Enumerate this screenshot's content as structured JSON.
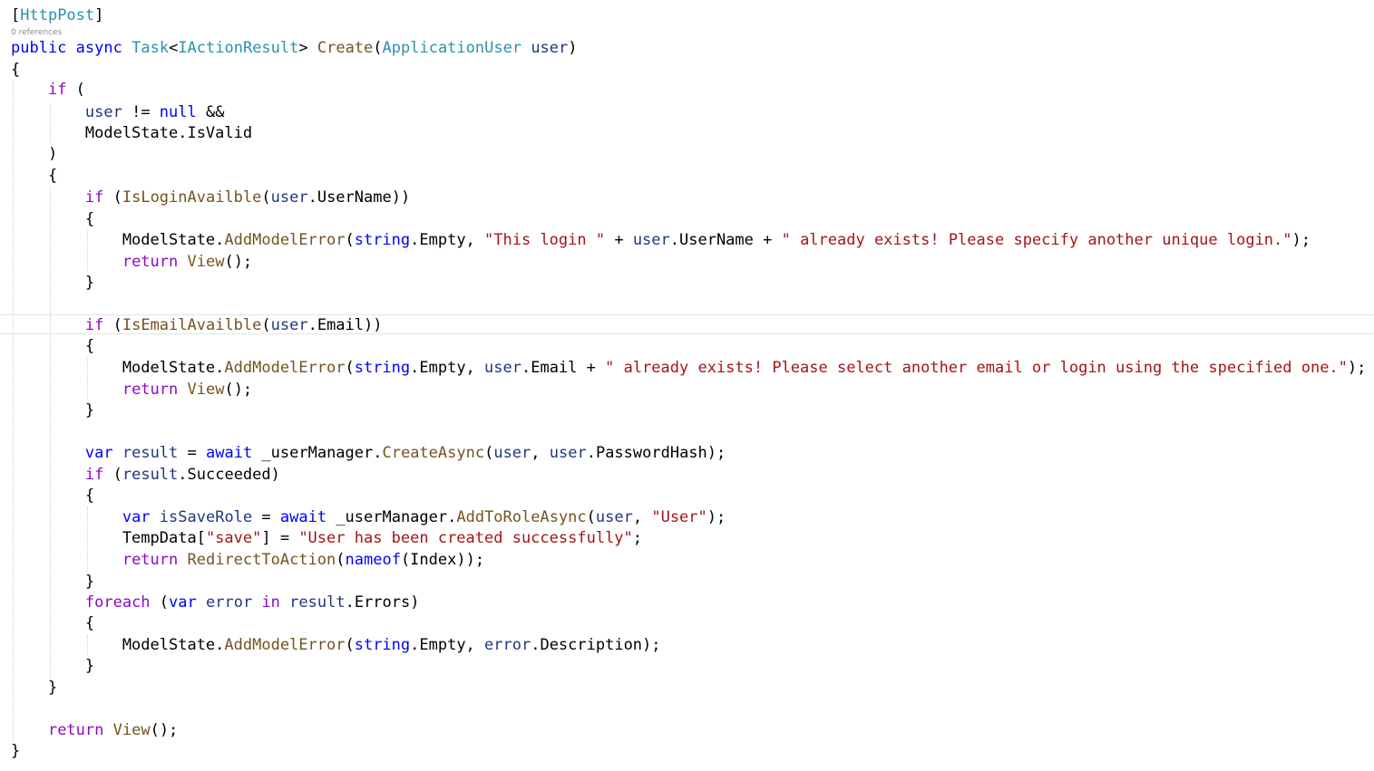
{
  "codelens_text": "0 references",
  "colors": {
    "keyword": "#0000ff",
    "type": "#2b91af",
    "method": "#74531f",
    "string": "#a31515",
    "local_variable": "#1f377f",
    "control_keyword": "#8f08c4",
    "plain": "#000000"
  },
  "lines": [
    [
      [
        "plain",
        "["
      ],
      [
        "type",
        "HttpPost"
      ],
      [
        "plain",
        "]"
      ]
    ],
    [
      [
        "kw",
        "public"
      ],
      [
        "plain",
        " "
      ],
      [
        "kw",
        "async"
      ],
      [
        "plain",
        " "
      ],
      [
        "type",
        "Task"
      ],
      [
        "plain",
        "<"
      ],
      [
        "type",
        "IActionResult"
      ],
      [
        "plain",
        "> "
      ],
      [
        "method",
        "Create"
      ],
      [
        "plain",
        "("
      ],
      [
        "type",
        "ApplicationUser"
      ],
      [
        "plain",
        " "
      ],
      [
        "var",
        "user"
      ],
      [
        "plain",
        ")"
      ]
    ],
    [
      [
        "plain",
        "{"
      ]
    ],
    [
      [
        "plain",
        "    "
      ],
      [
        "ctrl",
        "if"
      ],
      [
        "plain",
        " ("
      ]
    ],
    [
      [
        "plain",
        "        "
      ],
      [
        "var",
        "user"
      ],
      [
        "plain",
        " != "
      ],
      [
        "kw",
        "null"
      ],
      [
        "plain",
        " &&"
      ]
    ],
    [
      [
        "plain",
        "        ModelState.IsValid"
      ]
    ],
    [
      [
        "plain",
        "    )"
      ]
    ],
    [
      [
        "plain",
        "    {"
      ]
    ],
    [
      [
        "plain",
        "        "
      ],
      [
        "ctrl",
        "if"
      ],
      [
        "plain",
        " ("
      ],
      [
        "method",
        "IsLoginAvailble"
      ],
      [
        "plain",
        "("
      ],
      [
        "var",
        "user"
      ],
      [
        "plain",
        ".UserName))"
      ]
    ],
    [
      [
        "plain",
        "        {"
      ]
    ],
    [
      [
        "plain",
        "            ModelState."
      ],
      [
        "method",
        "AddModelError"
      ],
      [
        "plain",
        "("
      ],
      [
        "kw",
        "string"
      ],
      [
        "plain",
        ".Empty, "
      ],
      [
        "str",
        "\"This login \""
      ],
      [
        "plain",
        " + "
      ],
      [
        "var",
        "user"
      ],
      [
        "plain",
        ".UserName + "
      ],
      [
        "str",
        "\" already exists! Please specify another unique login.\""
      ],
      [
        "plain",
        ");"
      ]
    ],
    [
      [
        "plain",
        "            "
      ],
      [
        "ctrl",
        "return"
      ],
      [
        "plain",
        " "
      ],
      [
        "method",
        "View"
      ],
      [
        "plain",
        "();"
      ]
    ],
    [
      [
        "plain",
        "        }"
      ]
    ],
    [],
    [
      [
        "plain",
        "        "
      ],
      [
        "ctrl",
        "if"
      ],
      [
        "plain",
        " ("
      ],
      [
        "method",
        "IsEmailAvailble"
      ],
      [
        "plain",
        "("
      ],
      [
        "var",
        "user"
      ],
      [
        "plain",
        ".Email))"
      ]
    ],
    [
      [
        "plain",
        "        {"
      ]
    ],
    [
      [
        "plain",
        "            ModelState."
      ],
      [
        "method",
        "AddModelError"
      ],
      [
        "plain",
        "("
      ],
      [
        "kw",
        "string"
      ],
      [
        "plain",
        ".Empty, "
      ],
      [
        "var",
        "user"
      ],
      [
        "plain",
        ".Email + "
      ],
      [
        "str",
        "\" already exists! Please select another email or login using the specified one.\""
      ],
      [
        "plain",
        ");"
      ]
    ],
    [
      [
        "plain",
        "            "
      ],
      [
        "ctrl",
        "return"
      ],
      [
        "plain",
        " "
      ],
      [
        "method",
        "View"
      ],
      [
        "plain",
        "();"
      ]
    ],
    [
      [
        "plain",
        "        }"
      ]
    ],
    [],
    [
      [
        "plain",
        "        "
      ],
      [
        "kw",
        "var"
      ],
      [
        "plain",
        " "
      ],
      [
        "var",
        "result"
      ],
      [
        "plain",
        " = "
      ],
      [
        "kw",
        "await"
      ],
      [
        "plain",
        " _userManager."
      ],
      [
        "method",
        "CreateAsync"
      ],
      [
        "plain",
        "("
      ],
      [
        "var",
        "user"
      ],
      [
        "plain",
        ", "
      ],
      [
        "var",
        "user"
      ],
      [
        "plain",
        ".PasswordHash);"
      ]
    ],
    [
      [
        "plain",
        "        "
      ],
      [
        "ctrl",
        "if"
      ],
      [
        "plain",
        " ("
      ],
      [
        "var",
        "result"
      ],
      [
        "plain",
        ".Succeeded)"
      ]
    ],
    [
      [
        "plain",
        "        {"
      ]
    ],
    [
      [
        "plain",
        "            "
      ],
      [
        "kw",
        "var"
      ],
      [
        "plain",
        " "
      ],
      [
        "var",
        "isSaveRole"
      ],
      [
        "plain",
        " = "
      ],
      [
        "kw",
        "await"
      ],
      [
        "plain",
        " _userManager."
      ],
      [
        "method",
        "AddToRoleAsync"
      ],
      [
        "plain",
        "("
      ],
      [
        "var",
        "user"
      ],
      [
        "plain",
        ", "
      ],
      [
        "str",
        "\"User\""
      ],
      [
        "plain",
        ");"
      ]
    ],
    [
      [
        "plain",
        "            TempData["
      ],
      [
        "str",
        "\"save\""
      ],
      [
        "plain",
        "] = "
      ],
      [
        "str",
        "\"User has been created successfully\""
      ],
      [
        "plain",
        ";"
      ]
    ],
    [
      [
        "plain",
        "            "
      ],
      [
        "ctrl",
        "return"
      ],
      [
        "plain",
        " "
      ],
      [
        "method",
        "RedirectToAction"
      ],
      [
        "plain",
        "("
      ],
      [
        "kw",
        "nameof"
      ],
      [
        "plain",
        "(Index));"
      ]
    ],
    [
      [
        "plain",
        "        }"
      ]
    ],
    [
      [
        "plain",
        "        "
      ],
      [
        "ctrl",
        "foreach"
      ],
      [
        "plain",
        " ("
      ],
      [
        "kw",
        "var"
      ],
      [
        "plain",
        " "
      ],
      [
        "var",
        "error"
      ],
      [
        "plain",
        " "
      ],
      [
        "ctrl",
        "in"
      ],
      [
        "plain",
        " "
      ],
      [
        "var",
        "result"
      ],
      [
        "plain",
        ".Errors)"
      ]
    ],
    [
      [
        "plain",
        "        {"
      ]
    ],
    [
      [
        "plain",
        "            ModelState."
      ],
      [
        "method",
        "AddModelError"
      ],
      [
        "plain",
        "("
      ],
      [
        "kw",
        "string"
      ],
      [
        "plain",
        ".Empty, "
      ],
      [
        "var",
        "error"
      ],
      [
        "plain",
        ".Description);"
      ]
    ],
    [
      [
        "plain",
        "        }"
      ]
    ],
    [
      [
        "plain",
        "    }"
      ]
    ],
    [],
    [
      [
        "plain",
        "    "
      ],
      [
        "ctrl",
        "return"
      ],
      [
        "plain",
        " "
      ],
      [
        "method",
        "View"
      ],
      [
        "plain",
        "();"
      ]
    ],
    [
      [
        "plain",
        "}"
      ]
    ]
  ]
}
